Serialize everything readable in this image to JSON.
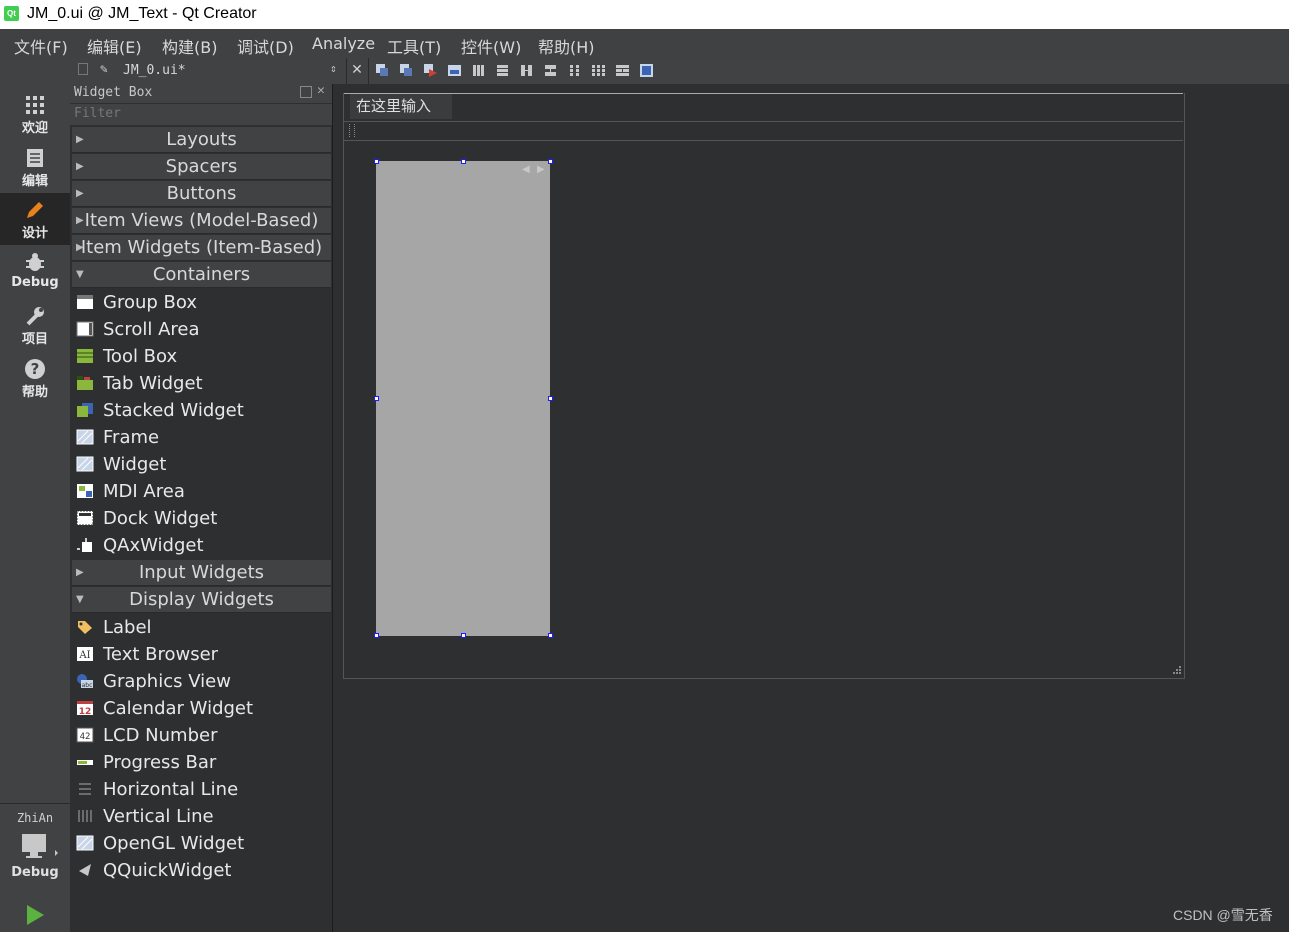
{
  "window": {
    "title": "JM_0.ui @ JM_Text - Qt Creator",
    "app_icon_text": "Qt"
  },
  "menu": [
    "文件(F)",
    "编辑(E)",
    "构建(B)",
    "调试(D)",
    "Analyze",
    "工具(T)",
    "控件(W)",
    "帮助(H)"
  ],
  "modes": [
    {
      "label": "欢迎",
      "icon": "grid-icon"
    },
    {
      "label": "编辑",
      "icon": "document-icon"
    },
    {
      "label": "设计",
      "icon": "pencil-icon"
    },
    {
      "label": "Debug",
      "icon": "bug-icon"
    },
    {
      "label": "项目",
      "icon": "wrench-icon"
    },
    {
      "label": "帮助",
      "icon": "help-icon"
    }
  ],
  "kit": {
    "project": "ZhiAn",
    "config": "Debug"
  },
  "editor": {
    "file_name": "JM_0.ui*"
  },
  "widget_box": {
    "title": "Widget Box",
    "filter_placeholder": "Filter",
    "categories_top": [
      "Layouts",
      "Spacers",
      "Buttons",
      "Item Views (Model-Based)",
      "Item Widgets (Item-Based)",
      "Containers"
    ],
    "containers": [
      "Group Box",
      "Scroll Area",
      "Tool Box",
      "Tab Widget",
      "Stacked Widget",
      "Frame",
      "Widget",
      "MDI Area",
      "Dock Widget",
      "QAxWidget"
    ],
    "categories_mid": [
      "Input Widgets",
      "Display Widgets"
    ],
    "display_widgets": [
      "Label",
      "Text Browser",
      "Graphics View",
      "Calendar Widget",
      "LCD Number",
      "Progress Bar",
      "Horizontal Line",
      "Vertical Line",
      "OpenGL Widget",
      "QQuickWidget"
    ]
  },
  "form": {
    "menu_placeholder": "在这里输入"
  },
  "watermark": "CSDN @雪无香",
  "colors": {
    "accent": "#1c1cff",
    "design_mode_icon": "#e8821e",
    "run": "#5bb240"
  }
}
